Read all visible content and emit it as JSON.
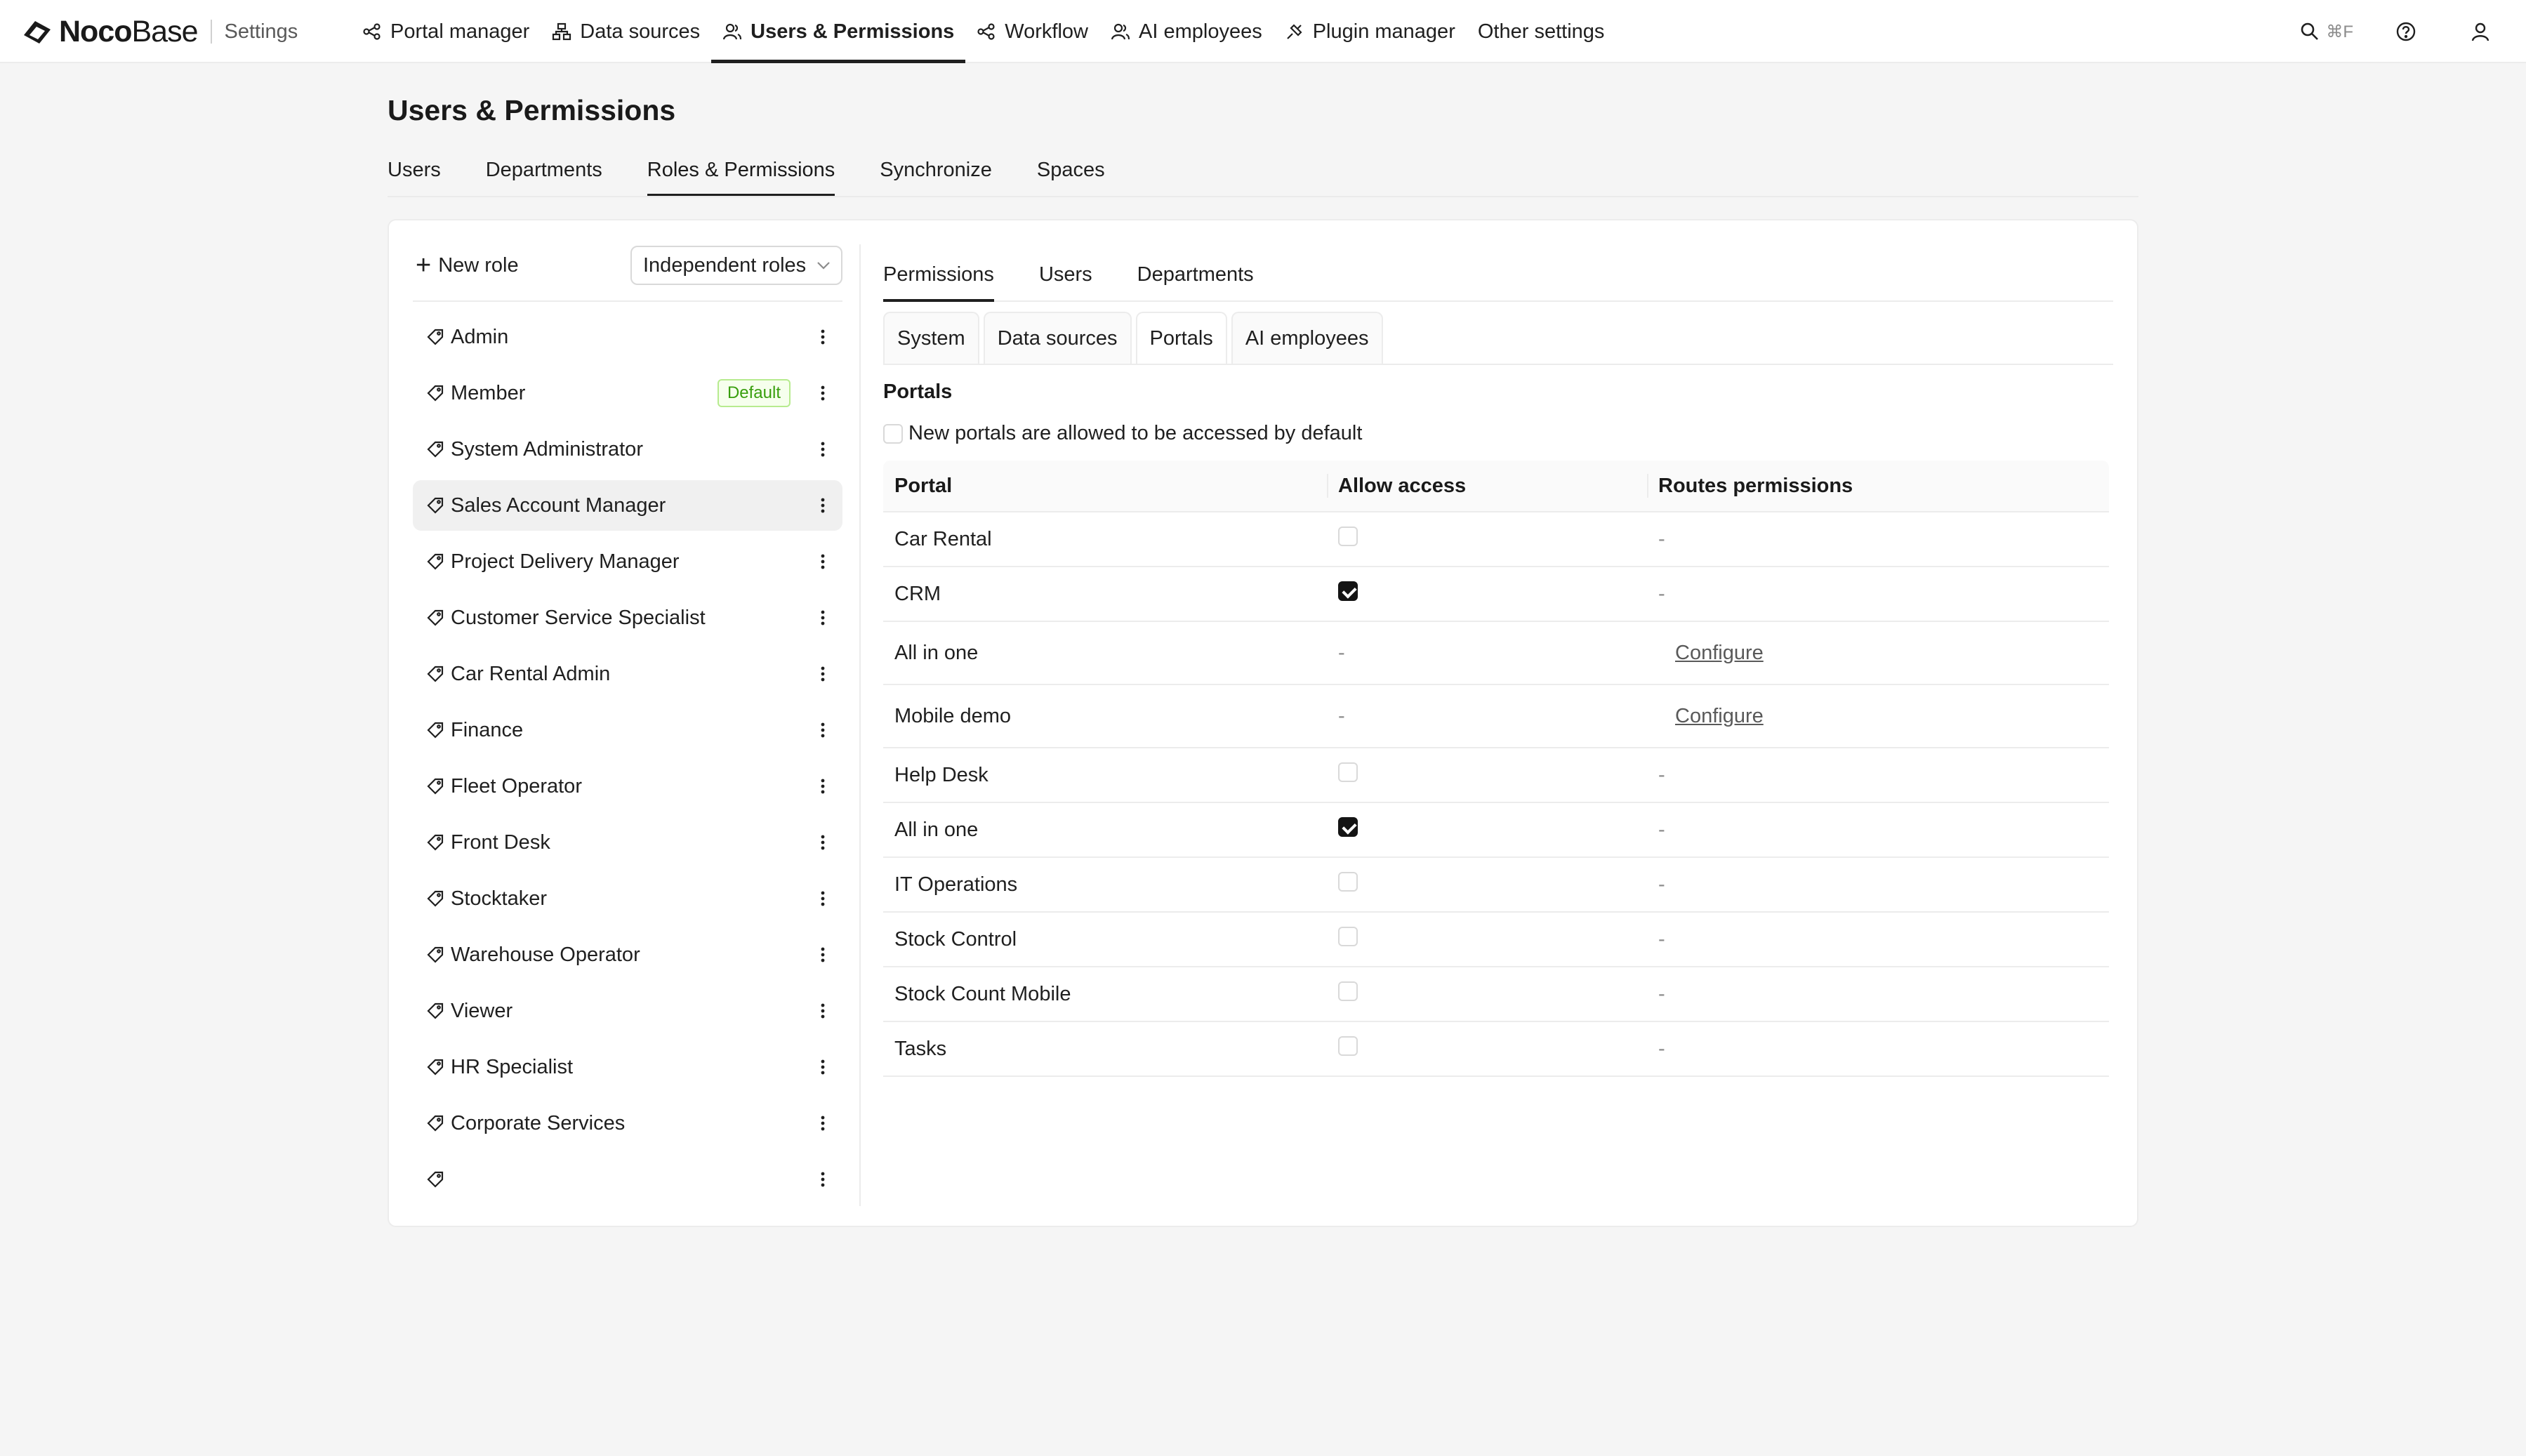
{
  "brand": {
    "noco": "Noco",
    "base": "Base",
    "settings": "Settings"
  },
  "topnav": [
    {
      "label": "Portal manager",
      "icon": "portal-icon"
    },
    {
      "label": "Data sources",
      "icon": "data-sources-icon"
    },
    {
      "label": "Users & Permissions",
      "icon": "users-icon",
      "active": true
    },
    {
      "label": "Workflow",
      "icon": "workflow-icon"
    },
    {
      "label": "AI employees",
      "icon": "ai-employees-icon"
    },
    {
      "label": "Plugin manager",
      "icon": "plugin-icon"
    },
    {
      "label": "Other settings",
      "icon": ""
    }
  ],
  "topright": {
    "search_shortcut": "⌘F"
  },
  "page": {
    "title": "Users & Permissions",
    "tabs": [
      "Users",
      "Departments",
      "Roles & Permissions",
      "Synchronize",
      "Spaces"
    ],
    "active_tab": "Roles & Permissions"
  },
  "roles": {
    "new_role_label": "New role",
    "mode_select": "Independent roles",
    "default_badge": "Default",
    "items": [
      "Admin",
      "Member",
      "System Administrator",
      "Sales Account Manager",
      "Project Delivery Manager",
      "Customer Service Specialist",
      "Car Rental Admin",
      "Finance",
      "Fleet Operator",
      "Front Desk",
      "Stocktaker",
      "Warehouse Operator",
      "Viewer",
      "HR Specialist",
      "Corporate Services",
      ""
    ],
    "selected": "Sales Account Manager"
  },
  "right_tabs": [
    "Permissions",
    "Users",
    "Departments"
  ],
  "sub_tabs": [
    "System",
    "Data sources",
    "Portals",
    "AI employees"
  ],
  "portals": {
    "title": "Portals",
    "default_access_label": "New portals are allowed to be accessed by default",
    "default_access_checked": false,
    "columns": [
      "Portal",
      "Allow access",
      "Routes permissions"
    ],
    "dash": "-",
    "rows": [
      {
        "name": "Car Rental",
        "access": "unchecked",
        "routes": "-"
      },
      {
        "name": "CRM",
        "access": "checked",
        "routes": "-"
      },
      {
        "name": "All in one",
        "access": "-",
        "routes": "Configure"
      },
      {
        "name": "Mobile demo",
        "access": "-",
        "routes": "Configure"
      },
      {
        "name": "Help Desk",
        "access": "unchecked",
        "routes": "-"
      },
      {
        "name": "All in one",
        "access": "checked",
        "routes": "-"
      },
      {
        "name": "IT Operations",
        "access": "unchecked",
        "routes": "-"
      },
      {
        "name": "Stock Control",
        "access": "unchecked",
        "routes": "-"
      },
      {
        "name": "Stock Count Mobile",
        "access": "unchecked",
        "routes": "-"
      },
      {
        "name": "Tasks",
        "access": "unchecked",
        "routes": "-"
      }
    ]
  }
}
